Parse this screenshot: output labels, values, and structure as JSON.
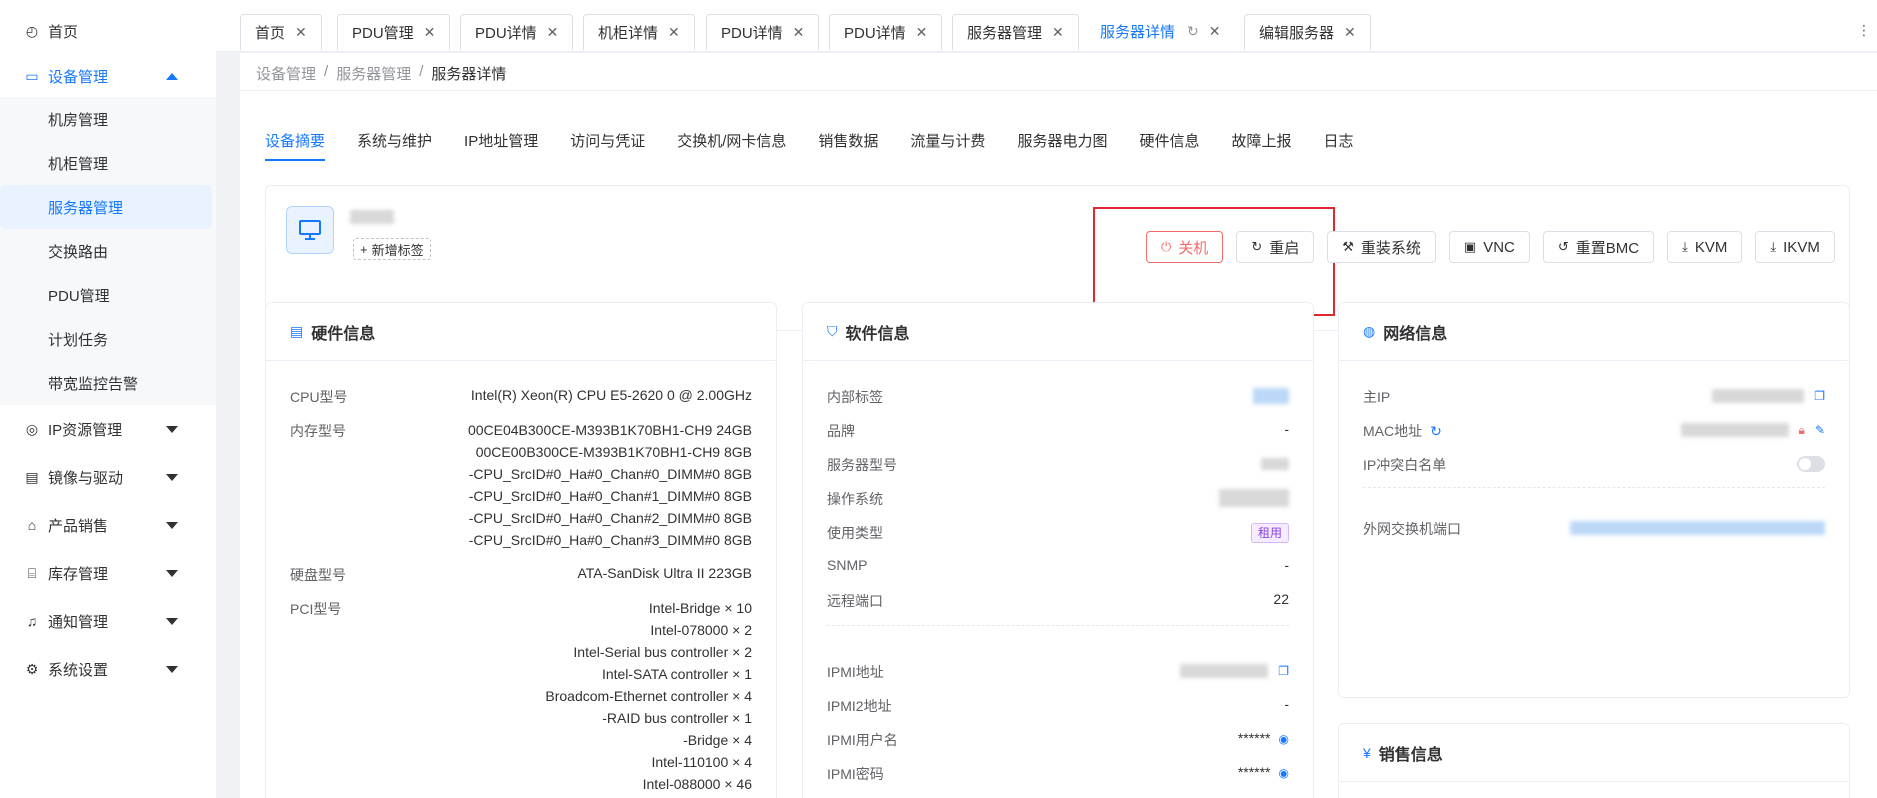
{
  "sidebar": {
    "items": [
      {
        "label": "首页",
        "icon": "dashboard-icon"
      },
      {
        "label": "设备管理",
        "icon": "monitor-icon",
        "expanded": true
      },
      {
        "label": "IP资源管理",
        "icon": "ip-icon"
      },
      {
        "label": "镜像与驱动",
        "icon": "image-icon"
      },
      {
        "label": "产品销售",
        "icon": "shop-icon"
      },
      {
        "label": "库存管理",
        "icon": "warehouse-icon"
      },
      {
        "label": "通知管理",
        "icon": "bell-icon"
      },
      {
        "label": "系统设置",
        "icon": "gear-icon"
      }
    ],
    "device_sub": [
      "机房管理",
      "机柜管理",
      "服务器管理",
      "交换路由",
      "PDU管理",
      "计划任务",
      "带宽监控告警"
    ]
  },
  "tabs": [
    "首页",
    "PDU管理",
    "PDU详情",
    "机柜详情",
    "PDU详情",
    "PDU详情",
    "服务器管理",
    "服务器详情",
    "编辑服务器"
  ],
  "breadcrumb": [
    "设备管理",
    "服务器管理",
    "服务器详情"
  ],
  "page_tabs": [
    "设备摘要",
    "系统与维护",
    "IP地址管理",
    "访问与凭证",
    "交换机/网卡信息",
    "销售数据",
    "流量与计费",
    "服务器电力图",
    "硬件信息",
    "故障上报",
    "日志"
  ],
  "device": {
    "add_tag": "新增标签",
    "actions": [
      "关机",
      "重启",
      "重装系统",
      "VNC",
      "重置BMC",
      "KVM",
      "IKVM"
    ]
  },
  "hardware": {
    "title": "硬件信息",
    "cpu_label": "CPU型号",
    "cpu_value": "Intel(R) Xeon(R) CPU E5-2620 0 @ 2.00GHz",
    "mem_label": "内存型号",
    "mem_values": [
      "00CE04B300CE-M393B1K70BH1-CH9 24GB",
      "00CE00B300CE-M393B1K70BH1-CH9 8GB",
      "-CPU_SrcID#0_Ha#0_Chan#0_DIMM#0 8GB",
      "-CPU_SrcID#0_Ha#0_Chan#1_DIMM#0 8GB",
      "-CPU_SrcID#0_Ha#0_Chan#2_DIMM#0 8GB",
      "-CPU_SrcID#0_Ha#0_Chan#3_DIMM#0 8GB"
    ],
    "disk_label": "硬盘型号",
    "disk_value": "ATA-SanDisk Ultra II 223GB",
    "pci_label": "PCI型号",
    "pci_values": [
      "Intel-Bridge × 10",
      "Intel-078000 × 2",
      "Intel-Serial bus controller × 2",
      "Intel-SATA controller × 1",
      "Broadcom-Ethernet controller × 4",
      "-RAID bus controller × 1",
      "-Bridge × 4",
      "Intel-110100 × 4",
      "Intel-088000 × 46"
    ]
  },
  "software": {
    "title": "软件信息",
    "internal_tag_label": "内部标签",
    "brand_label": "品牌",
    "brand_value": "-",
    "model_label": "服务器型号",
    "os_label": "操作系统",
    "usage_label": "使用类型",
    "usage_value": "租用",
    "snmp_label": "SNMP",
    "snmp_value": "-",
    "port_label": "远程端口",
    "port_value": "22",
    "ipmi_label": "IPMI地址",
    "ipmi2_label": "IPMI2地址",
    "ipmi2_value": "-",
    "ipmi_user_label": "IPMI用户名",
    "ipmi_user_value": "******",
    "ipmi_pwd_label": "IPMI密码",
    "ipmi_pwd_value": "******"
  },
  "network": {
    "title": "网络信息",
    "main_ip_label": "主IP",
    "mac_label": "MAC地址",
    "whitelist_label": "IP冲突白名单",
    "switch_port_label": "外网交换机端口"
  },
  "sales": {
    "title": "销售信息"
  }
}
